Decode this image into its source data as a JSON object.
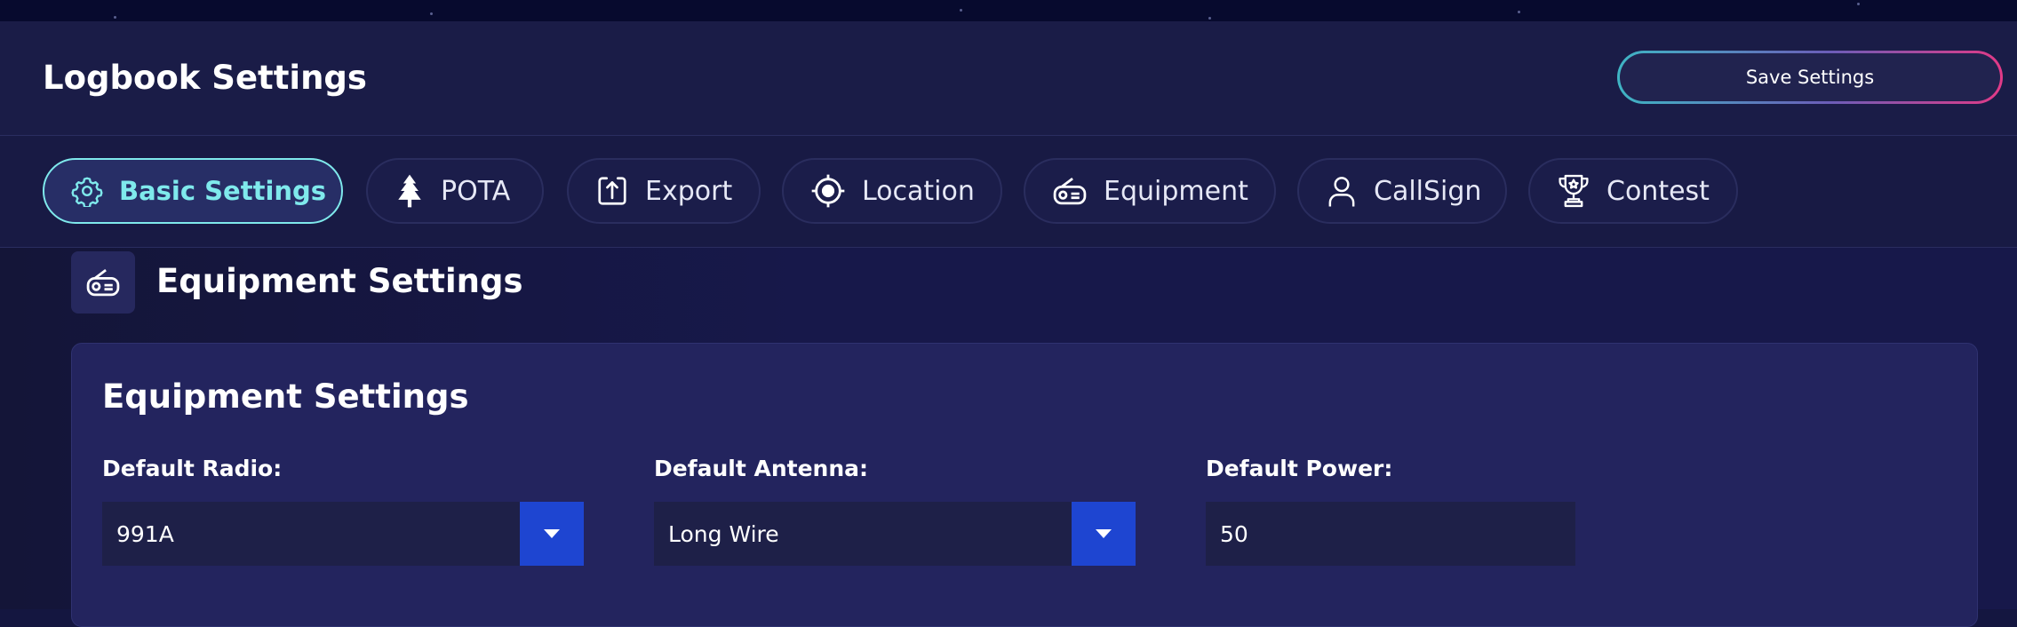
{
  "header": {
    "title": "Logbook Settings",
    "save_label": "Save Settings"
  },
  "tabs": [
    {
      "label": "Basic Settings",
      "icon": "gear-icon",
      "active": true
    },
    {
      "label": "POTA",
      "icon": "tree-icon",
      "active": false
    },
    {
      "label": "Export",
      "icon": "export-icon",
      "active": false
    },
    {
      "label": "Location",
      "icon": "crosshair-icon",
      "active": false
    },
    {
      "label": "Equipment",
      "icon": "radio-icon",
      "active": false
    },
    {
      "label": "CallSign",
      "icon": "user-icon",
      "active": false
    },
    {
      "label": "Contest",
      "icon": "trophy-icon",
      "active": false
    }
  ],
  "section": {
    "icon": "radio-icon",
    "title": "Equipment Settings"
  },
  "card": {
    "title": "Equipment Settings",
    "fields": {
      "radio": {
        "label": "Default Radio:",
        "value": "991A"
      },
      "antenna": {
        "label": "Default Antenna:",
        "value": "Long Wire"
      },
      "power": {
        "label": "Default Power:",
        "value": "50"
      }
    }
  },
  "colors": {
    "accent": "#7fe9ec",
    "select_button": "#1e45d1",
    "background": "#141640"
  }
}
